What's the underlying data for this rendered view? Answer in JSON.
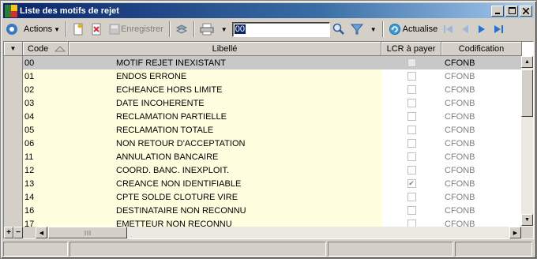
{
  "window": {
    "title": "Liste des motifs de rejet"
  },
  "toolbar": {
    "actions_label": "Actions",
    "save_label": "Enregistrer",
    "search_value": "00",
    "refresh_label": "Actualise"
  },
  "grid": {
    "columns": [
      "Code",
      "Libellé",
      "LCR à payer",
      "Codification"
    ],
    "rows": [
      {
        "code": "00",
        "label": "MOTIF REJET INEXISTANT",
        "lcr": false,
        "codif": "CFONB"
      },
      {
        "code": "01",
        "label": "ENDOS ERRONE",
        "lcr": false,
        "codif": "CFONB"
      },
      {
        "code": "02",
        "label": "ECHEANCE HORS LIMITE",
        "lcr": false,
        "codif": "CFONB"
      },
      {
        "code": "03",
        "label": "DATE INCOHERENTE",
        "lcr": false,
        "codif": "CFONB"
      },
      {
        "code": "04",
        "label": "RECLAMATION PARTIELLE",
        "lcr": false,
        "codif": "CFONB"
      },
      {
        "code": "05",
        "label": "RECLAMATION TOTALE",
        "lcr": false,
        "codif": "CFONB"
      },
      {
        "code": "06",
        "label": "NON RETOUR D'ACCEPTATION",
        "lcr": false,
        "codif": "CFONB"
      },
      {
        "code": "11",
        "label": "ANNULATION BANCAIRE",
        "lcr": false,
        "codif": "CFONB"
      },
      {
        "code": "12",
        "label": "COORD. BANC. INEXPLOIT.",
        "lcr": false,
        "codif": "CFONB"
      },
      {
        "code": "13",
        "label": "CREANCE NON IDENTIFIABLE",
        "lcr": true,
        "codif": "CFONB"
      },
      {
        "code": "14",
        "label": "CPTE SOLDE CLOTURE VIRE",
        "lcr": false,
        "codif": "CFONB"
      },
      {
        "code": "16",
        "label": "DESTINATAIRE NON RECONNU",
        "lcr": false,
        "codif": "CFONB"
      },
      {
        "code": "17",
        "label": "EMETTEUR NON RECONNU",
        "lcr": false,
        "codif": "CFONB"
      }
    ],
    "selected_index": 0
  }
}
